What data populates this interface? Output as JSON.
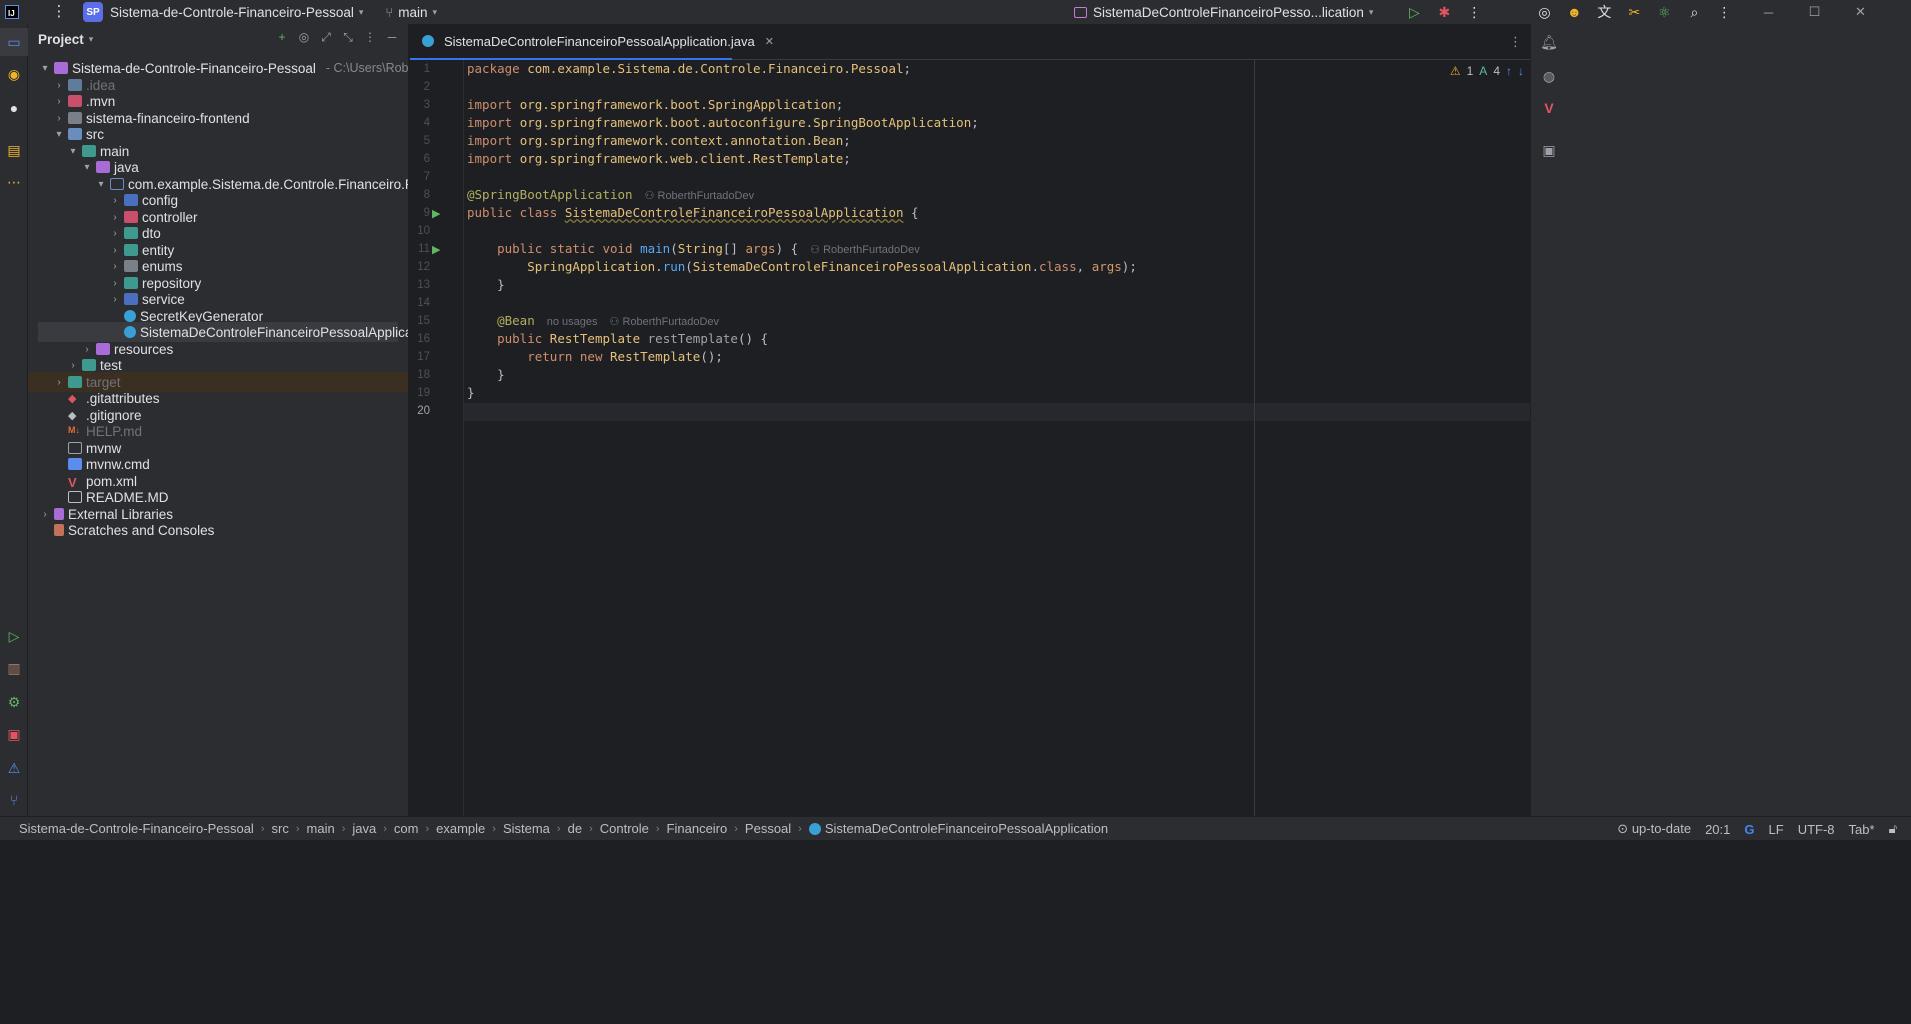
{
  "titlebar": {
    "project_badge": "SP",
    "project_name": "Sistema-de-Controle-Financeiro-Pessoal",
    "branch": "main",
    "run_config": "SistemaDeControleFinanceiroPesso...lication"
  },
  "project_panel": {
    "title": "Project",
    "root_name": "Sistema-de-Controle-Financeiro-Pessoal",
    "root_path": "- C:\\Users\\Roberth Furta",
    "items": [
      {
        "label": ".idea"
      },
      {
        "label": ".mvn"
      },
      {
        "label": "sistema-financeiro-frontend"
      },
      {
        "label": "src"
      },
      {
        "label": "main"
      },
      {
        "label": "java"
      },
      {
        "label": "com.example.Sistema.de.Controle.Financeiro.Pessoal"
      },
      {
        "label": "config"
      },
      {
        "label": "controller"
      },
      {
        "label": "dto"
      },
      {
        "label": "entity"
      },
      {
        "label": "enums"
      },
      {
        "label": "repository"
      },
      {
        "label": "service"
      },
      {
        "label": "SecretKeyGenerator"
      },
      {
        "label": "SistemaDeControleFinanceiroPessoalApplication"
      },
      {
        "label": "resources"
      },
      {
        "label": "test"
      },
      {
        "label": "target"
      },
      {
        "label": ".gitattributes"
      },
      {
        "label": ".gitignore"
      },
      {
        "label": "HELP.md"
      },
      {
        "label": "mvnw"
      },
      {
        "label": "mvnw.cmd"
      },
      {
        "label": "pom.xml"
      },
      {
        "label": "README.MD"
      },
      {
        "label": "External Libraries"
      },
      {
        "label": "Scratches and Consoles"
      }
    ]
  },
  "editor": {
    "tab_name": "SistemaDeControleFinanceiroPessoalApplication.java",
    "warnings": "1",
    "typos": "4",
    "author": "RoberthFurtadoDev",
    "no_usages": "no usages",
    "lines": [
      "package com.example.Sistema.de.Controle.Financeiro.Pessoal;",
      "",
      "import org.springframework.boot.SpringApplication;",
      "import org.springframework.boot.autoconfigure.SpringBootApplication;",
      "import org.springframework.context.annotation.Bean;",
      "import org.springframework.web.client.RestTemplate;",
      "",
      "@SpringBootApplication",
      "public class SistemaDeControleFinanceiroPessoalApplication {",
      "",
      "    public static void main(String[] args) {",
      "        SpringApplication.run(SistemaDeControleFinanceiroPessoalApplication.class, args);",
      "    }",
      "",
      "    @Bean",
      "    public RestTemplate restTemplate() {",
      "        return new RestTemplate();",
      "    }",
      "}",
      ""
    ]
  },
  "statusbar": {
    "breadcrumbs": [
      "Sistema-de-Controle-Financeiro-Pessoal",
      "src",
      "main",
      "java",
      "com",
      "example",
      "Sistema",
      "de",
      "Controle",
      "Financeiro",
      "Pessoal",
      "SistemaDeControleFinanceiroPessoalApplication"
    ],
    "vcs_status": "up-to-date",
    "caret": "20:1",
    "line_sep": "LF",
    "encoding": "UTF-8",
    "indent": "Tab*"
  }
}
